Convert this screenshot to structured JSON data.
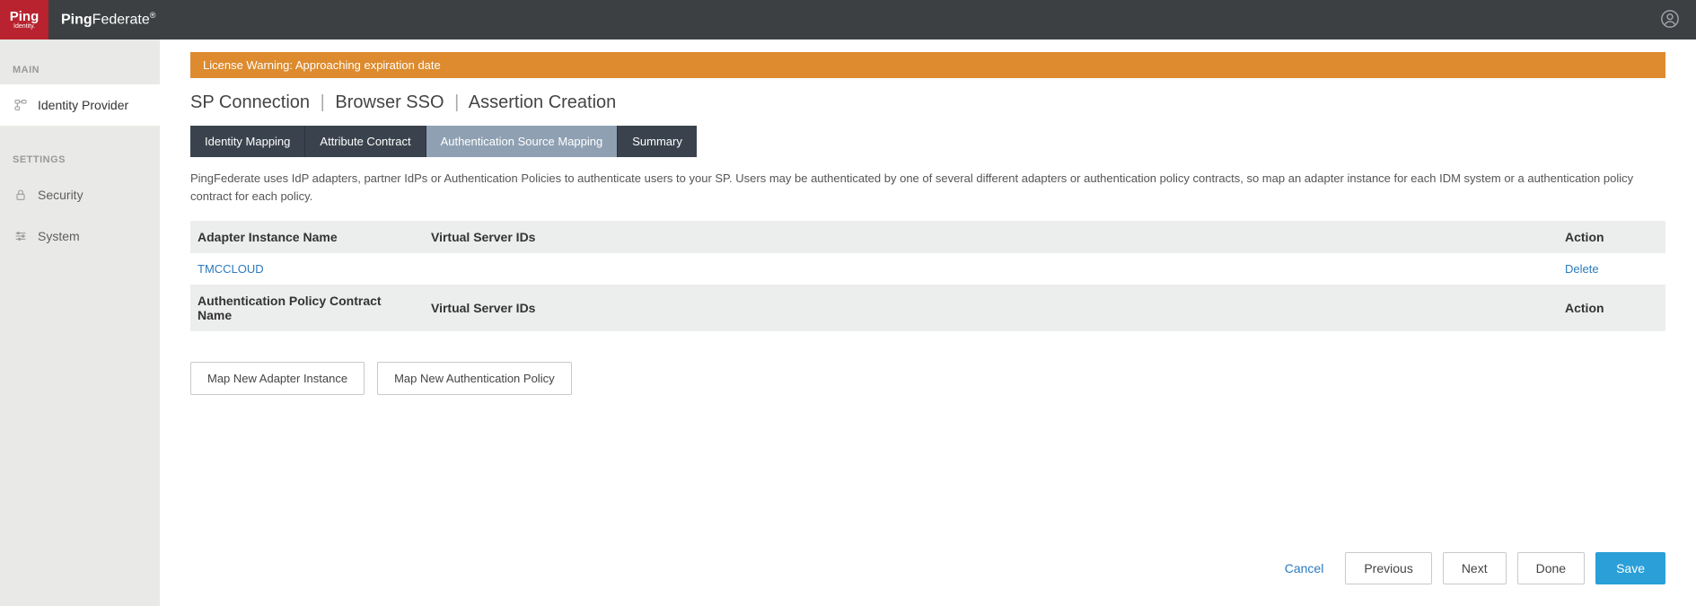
{
  "brand": {
    "ping": "Ping",
    "identity": "Identity.",
    "federate_bold": "Ping",
    "federate_light": "Federate"
  },
  "sidebar": {
    "main_heading": "MAIN",
    "settings_heading": "SETTINGS",
    "items": {
      "identity_provider": "Identity Provider",
      "security": "Security",
      "system": "System"
    }
  },
  "warning": "License Warning: Approaching expiration date",
  "breadcrumb": {
    "sp_connection": "SP Connection",
    "browser_sso": "Browser SSO",
    "assertion_creation": "Assertion Creation"
  },
  "tabs": {
    "identity_mapping": "Identity Mapping",
    "attribute_contract": "Attribute Contract",
    "auth_source_mapping": "Authentication Source Mapping",
    "summary": "Summary"
  },
  "description": "PingFederate uses IdP adapters, partner IdPs or Authentication Policies to authenticate users to your SP. Users may be authenticated by one of several different adapters or authentication policy contracts, so map an adapter instance for each IDM system or a authentication policy contract for each policy.",
  "table1": {
    "headers": {
      "name": "Adapter Instance Name",
      "vsid": "Virtual Server IDs",
      "action": "Action"
    },
    "rows": [
      {
        "name": "TMCCLOUD",
        "vsid": "",
        "action": "Delete"
      }
    ]
  },
  "table2": {
    "headers": {
      "name": "Authentication Policy Contract Name",
      "vsid": "Virtual Server IDs",
      "action": "Action"
    }
  },
  "buttons": {
    "map_adapter": "Map New Adapter Instance",
    "map_auth": "Map New Authentication Policy"
  },
  "footer": {
    "cancel": "Cancel",
    "previous": "Previous",
    "next": "Next",
    "done": "Done",
    "save": "Save"
  }
}
